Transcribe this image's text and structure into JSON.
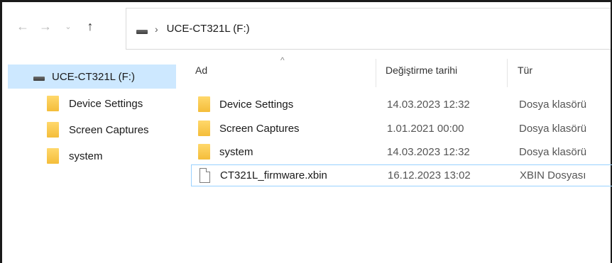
{
  "address": {
    "path_label": "UCE-CT321L (F:)"
  },
  "nav": {
    "back_icon": "←",
    "forward_icon": "→",
    "recent_icon": "⌄",
    "up_icon": "↑",
    "separator": "›"
  },
  "sidebar": {
    "drive_label": "UCE-CT321L (F:)",
    "items": [
      {
        "label": "Device Settings"
      },
      {
        "label": "Screen Captures"
      },
      {
        "label": "system"
      }
    ]
  },
  "columns": {
    "name": "Ad",
    "date": "Değiştirme tarihi",
    "type": "Tür"
  },
  "files": [
    {
      "name": "Device Settings",
      "date": "14.03.2023 12:32",
      "type": "Dosya klasörü",
      "kind": "folder"
    },
    {
      "name": "Screen Captures",
      "date": "1.01.2021 00:00",
      "type": "Dosya klasörü",
      "kind": "folder"
    },
    {
      "name": "system",
      "date": "14.03.2023 12:32",
      "type": "Dosya klasörü",
      "kind": "folder"
    },
    {
      "name": "CT321L_firmware.xbin",
      "date": "16.12.2023 13:02",
      "type": "XBIN Dosyası",
      "kind": "file"
    }
  ],
  "colors": {
    "selection": "#cde8ff",
    "hover_border": "#99d1ff",
    "folder": "#f4bd3a"
  }
}
